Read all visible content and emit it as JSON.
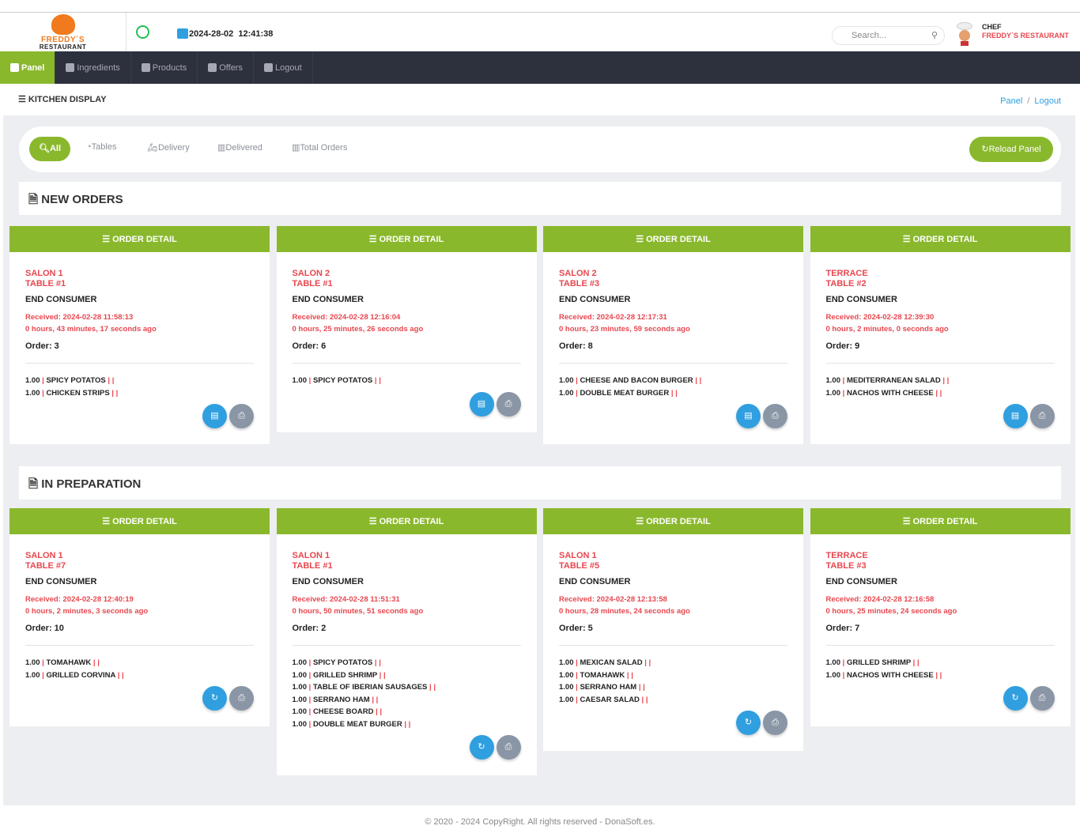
{
  "header": {
    "brand_line1": "FREDDY´S",
    "brand_line2": "RESTAURANT",
    "datetime": "2024-28-02  12:41:38",
    "search_placeholder": "Search...",
    "user_role": "CHEF",
    "user_name": "FREDDY´S RESTAURANT"
  },
  "nav": [
    {
      "label": "Panel",
      "icon": "monitor-icon",
      "active": true
    },
    {
      "label": "Ingredients",
      "icon": "box-icon"
    },
    {
      "label": "Products",
      "icon": "box-icon"
    },
    {
      "label": "Offers",
      "icon": "box-icon"
    },
    {
      "label": "Logout",
      "icon": "power-icon"
    }
  ],
  "breadcrumb": {
    "title": "KITCHEN DISPLAY",
    "links": [
      "Panel",
      "Logout"
    ],
    "sep": "/"
  },
  "filters": {
    "all": "All",
    "tables": "Tables",
    "delivery": "Delivery",
    "delivered": "Delivered",
    "total": "Total Orders",
    "reload": "Reload Panel"
  },
  "colors": {
    "accent": "#8ab82d",
    "red": "#e8474f",
    "blue": "#2f9fe0",
    "nav": "#2d303d"
  },
  "card_header": "ORDER DETAIL",
  "sections": {
    "new": "NEW ORDERS",
    "prep": "IN PREPARATION"
  },
  "new_orders": [
    {
      "zone": "SALON 1",
      "table": "TABLE #1",
      "customer": "END CONSUMER",
      "received": "Received: 2024-02-28 11:58:13",
      "ago": "0 hours, 43 minutes, 17 seconds ago",
      "order": "Order: 3",
      "items": [
        [
          "1.00",
          "SPICY POTATOS"
        ],
        [
          "1.00",
          "CHICKEN STRIPS"
        ]
      ]
    },
    {
      "zone": "SALON 2",
      "table": "TABLE #1",
      "customer": "END CONSUMER",
      "received": "Received: 2024-02-28 12:16:04",
      "ago": "0 hours, 25 minutes, 26 seconds ago",
      "order": "Order: 6",
      "items": [
        [
          "1.00",
          "SPICY POTATOS"
        ]
      ]
    },
    {
      "zone": "SALON 2",
      "table": "TABLE #3",
      "customer": "END CONSUMER",
      "received": "Received: 2024-02-28 12:17:31",
      "ago": "0 hours, 23 minutes, 59 seconds ago",
      "order": "Order: 8",
      "items": [
        [
          "1.00",
          "CHEESE AND BACON BURGER"
        ],
        [
          "1.00",
          "DOUBLE MEAT BURGER"
        ]
      ]
    },
    {
      "zone": "TERRACE",
      "table": "TABLE #2",
      "customer": "END CONSUMER",
      "received": "Received: 2024-02-28 12:39:30",
      "ago": "0 hours, 2 minutes, 0 seconds ago",
      "order": "Order: 9",
      "items": [
        [
          "1.00",
          "MEDITERRANEAN SALAD"
        ],
        [
          "1.00",
          "NACHOS WITH CHEESE"
        ]
      ]
    }
  ],
  "in_preparation": [
    {
      "zone": "SALON 1",
      "table": "TABLE #7",
      "customer": "END CONSUMER",
      "received": "Received: 2024-02-28 12:40:19",
      "ago": "0 hours, 2 minutes, 3 seconds ago",
      "order": "Order: 10",
      "items": [
        [
          "1.00",
          "TOMAHAWK"
        ],
        [
          "1.00",
          "GRILLED CORVINA"
        ]
      ]
    },
    {
      "zone": "SALON 1",
      "table": "TABLE #1",
      "customer": "END CONSUMER",
      "received": "Received: 2024-02-28 11:51:31",
      "ago": "0 hours, 50 minutes, 51 seconds ago",
      "order": "Order: 2",
      "items": [
        [
          "1.00",
          "SPICY POTATOS"
        ],
        [
          "1.00",
          "GRILLED SHRIMP"
        ],
        [
          "1.00",
          "TABLE OF IBERIAN SAUSAGES"
        ],
        [
          "1.00",
          "SERRANO HAM"
        ],
        [
          "1.00",
          "CHEESE BOARD"
        ],
        [
          "1.00",
          "DOUBLE MEAT BURGER"
        ]
      ]
    },
    {
      "zone": "SALON 1",
      "table": "TABLE #5",
      "customer": "END CONSUMER",
      "received": "Received: 2024-02-28 12:13:58",
      "ago": "0 hours, 28 minutes, 24 seconds ago",
      "order": "Order: 5",
      "items": [
        [
          "1.00",
          "MEXICAN SALAD"
        ],
        [
          "1.00",
          "TOMAHAWK"
        ],
        [
          "1.00",
          "SERRANO HAM"
        ],
        [
          "1.00",
          "CAESAR SALAD"
        ]
      ]
    },
    {
      "zone": "TERRACE",
      "table": "TABLE #3",
      "customer": "END CONSUMER",
      "received": "Received: 2024-02-28 12:16:58",
      "ago": "0 hours, 25 minutes, 24 seconds ago",
      "order": "Order: 7",
      "items": [
        [
          "1.00",
          "GRILLED SHRIMP"
        ],
        [
          "1.00",
          "NACHOS WITH CHEESE"
        ]
      ]
    }
  ],
  "footer": "© 2020 - 2024 CopyRight. All rights reserved - DonaSoft.es."
}
